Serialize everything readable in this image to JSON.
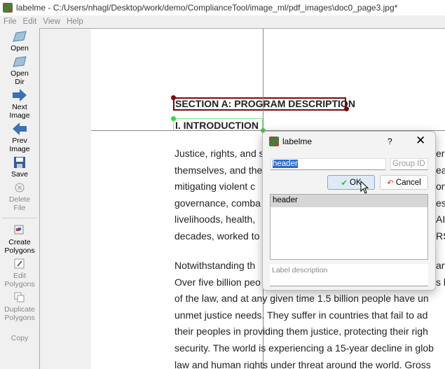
{
  "window": {
    "title": "labelme - C:/Users/nhagl/Desktop/work/demo/ComplianceTool/image_ml/pdf_images\\doc0_page3.jpg*"
  },
  "menu": [
    "File",
    "Edit",
    "View",
    "Help"
  ],
  "tools": [
    {
      "l1": "Open",
      "l2": ""
    },
    {
      "l1": "Open",
      "l2": "Dir"
    },
    {
      "l1": "Next",
      "l2": "Image"
    },
    {
      "l1": "Prev",
      "l2": "Image"
    },
    {
      "l1": "Save",
      "l2": ""
    },
    {
      "l1": "Delete",
      "l2": "File"
    },
    {
      "l1": "Create",
      "l2": "Polygons"
    },
    {
      "l1": "Edit",
      "l2": "Polygons"
    },
    {
      "l1": "Duplicate",
      "l2": "Polygons"
    },
    {
      "l1": "Copy",
      "l2": ""
    }
  ],
  "document": {
    "heading": "SECTION A: PROGRAM DESCRIPTION",
    "subheading": "I.  INTRODUCTION",
    "para1": [
      "Justice, rights, and s",
      "themselves, and the",
      "mitigating violent c",
      "governance, comba",
      "livelihoods, health,",
      "decades, worked to"
    ],
    "para1_right": [
      "er",
      "ea",
      "on",
      "ess",
      "AID",
      "RS"
    ],
    "para2": [
      "Notwithstanding th",
      "Over five billion peo",
      "of the law, and at any given time 1.5 billion people have un",
      "unmet justice needs. They suffer in countries that fail to ad",
      "their peoples in providing them justice, protecting their righ",
      "security. The world is experiencing a 15-year decline in glob",
      "law and human rights under threat around the world. Gross"
    ],
    "para2_right": [
      "anc",
      "s li"
    ]
  },
  "dialog": {
    "title": "labelme",
    "help": "?",
    "label_value": "header",
    "group_id_placeholder": "Group ID",
    "ok": "OK",
    "cancel": "Cancel",
    "labels": [
      "header"
    ],
    "description_placeholder": "Label description"
  }
}
